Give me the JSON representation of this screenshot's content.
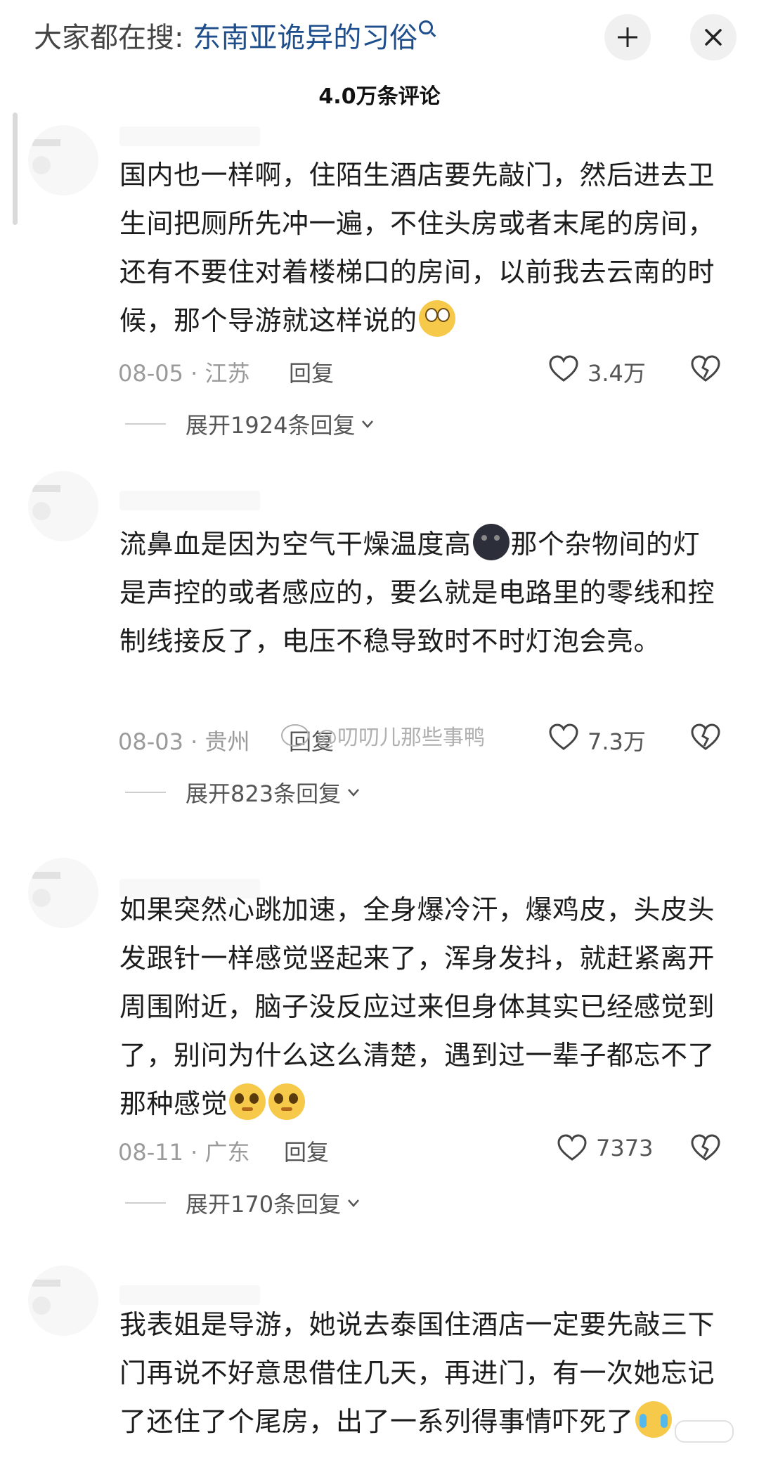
{
  "header": {
    "search_prefix": "大家都在搜:",
    "search_keyword": "东南亚诡异的习俗",
    "collapse_icon": "collapse-icon",
    "close_icon": "close-icon",
    "comment_count": "4.0万条评论"
  },
  "comments": [
    {
      "text_a": "国内也一样啊，住陌生酒店要先敲门，然后进去卫生间把厕所先冲一遍，不住头房或者末尾的房间，还有不要住对着楼梯口的房间，以前我去云南的时候，那个导游就这样说的",
      "text_b": "",
      "text_c": "",
      "date": "08-05",
      "location": "江苏",
      "reply_label": "回复",
      "likes": "3.4万",
      "expand": "展开1924条回复"
    },
    {
      "text_a": "流鼻血是因为空气干燥温度高",
      "text_b": "那个杂物间的灯是声控的或者感应的，要么就是电路里的零线和控制线接反了，电压不稳导致时不时灯泡会亮。",
      "text_c": "",
      "date": "08-03",
      "location": "贵州",
      "reply_label": "回复",
      "likes": "7.3万",
      "expand": "展开823条回复"
    },
    {
      "text_a": "如果突然心跳加速，全身爆冷汗，爆鸡皮，头皮头发跟针一样感觉竖起来了，浑身发抖，就赶紧离开周围附近，脑子没反应过来但身体其实已经感觉到了，别问为什么这么清楚，遇到过一辈子都忘不了那种感觉",
      "text_b": "",
      "text_c": "",
      "date": "08-11",
      "location": "广东",
      "reply_label": "回复",
      "likes": "7373",
      "expand": "展开170条回复"
    },
    {
      "text_a": "我表姐是导游，她说去泰国住酒店一定要先敲三下门再说不好意思借住几天，再进门，有一次她忘记了还住了个尾房，出了一系列得事情吓死了",
      "text_b": "",
      "text_c": ""
    }
  ],
  "watermark": "@叨叨儿那些事鸭",
  "colors": {
    "keyword": "#1f4e8c",
    "muted": "#9a9a9a",
    "text": "#1c1c1c"
  }
}
